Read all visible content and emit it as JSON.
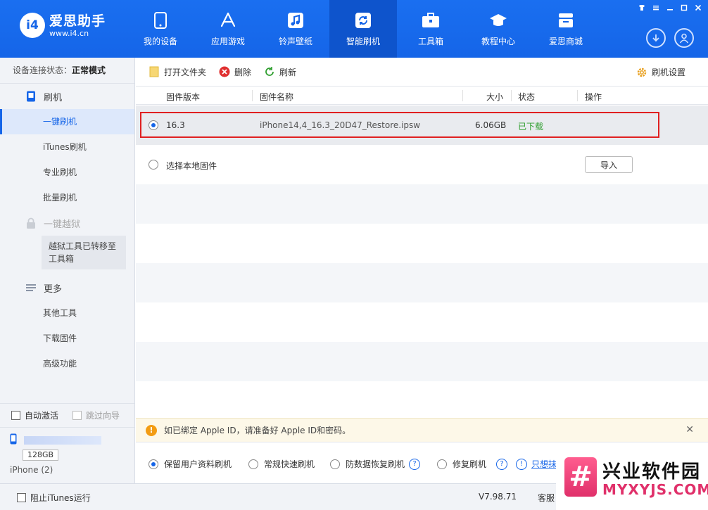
{
  "app": {
    "logo_mark": "i4",
    "logo_name": "爱思助手",
    "logo_url": "www.i4.cn"
  },
  "nav": [
    {
      "label": "我的设备",
      "icon": "phone-icon"
    },
    {
      "label": "应用游戏",
      "icon": "appstore-icon"
    },
    {
      "label": "铃声壁纸",
      "icon": "music-icon"
    },
    {
      "label": "智能刷机",
      "icon": "refresh-icon"
    },
    {
      "label": "工具箱",
      "icon": "toolbox-icon"
    },
    {
      "label": "教程中心",
      "icon": "graduation-cap-icon"
    },
    {
      "label": "爱思商城",
      "icon": "store-icon"
    }
  ],
  "sidebar": {
    "status_label": "设备连接状态：",
    "status_value": "正常模式",
    "flash_group": "刷机",
    "items": [
      "一键刷机",
      "iTunes刷机",
      "专业刷机",
      "批量刷机"
    ],
    "jailbreak_group": "一键越狱",
    "jailbreak_note": "越狱工具已转移至工具箱",
    "more_group": "更多",
    "more_items": [
      "其他工具",
      "下载固件",
      "高级功能"
    ],
    "auto_activate": "自动激活",
    "skip_guide": "跳过向导",
    "device_storage": "128GB",
    "device_model": "iPhone (2)"
  },
  "toolbar": {
    "open_folder": "打开文件夹",
    "delete": "删除",
    "refresh": "刷新",
    "settings": "刷机设置"
  },
  "table": {
    "headers": [
      "固件版本",
      "固件名称",
      "大小",
      "状态",
      "操作"
    ],
    "rows": [
      {
        "version": "16.3",
        "name": "iPhone14,4_16.3_20D47_Restore.ipsw",
        "size": "6.06GB",
        "status": "已下载"
      }
    ],
    "local_label": "选择本地固件",
    "import_label": "导入"
  },
  "notice": {
    "text": "如已绑定 Apple ID，请准备好 Apple ID和密码。"
  },
  "options": {
    "keep_data": "保留用户资料刷机",
    "quick": "常规快速刷机",
    "anti_recovery": "防数据恢复刷机",
    "repair": "修复刷机",
    "link": "只想抹"
  },
  "statusbar": {
    "block_itunes": "阻止iTunes运行",
    "version": "V7.98.71",
    "service": "客服"
  },
  "watermark": {
    "mark": "#",
    "title": "兴业软件园",
    "url": "MYXYJS.COM"
  },
  "colors": {
    "brand": "#1565e8",
    "downloaded": "#2e9e2e",
    "highlight": "#e02020"
  }
}
